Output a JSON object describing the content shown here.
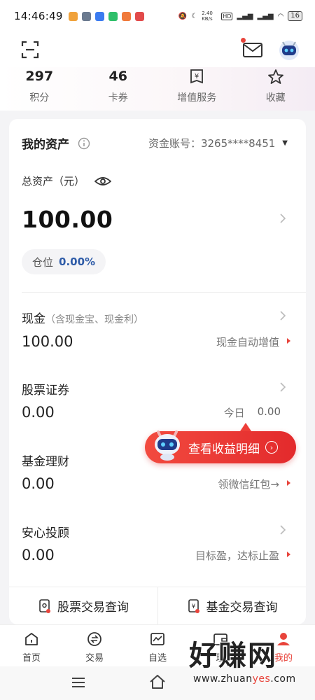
{
  "status_bar": {
    "time": "14:46:49",
    "net_speed": "2.40 KB/s",
    "battery": "16"
  },
  "stats": [
    {
      "value": "297",
      "label": "积分"
    },
    {
      "value": "46",
      "label": "卡券"
    },
    {
      "value": "",
      "label": "增值服务",
      "icon": "yen-bag-icon"
    },
    {
      "value": "",
      "label": "收藏",
      "icon": "star-icon"
    }
  ],
  "assets": {
    "title": "我的资产",
    "account": "资金账号：3265****8451",
    "total_label": "总资产（元）",
    "total_value": "100.00",
    "position_label": "仓位",
    "position_value": "0.00%"
  },
  "sections": {
    "cash": {
      "title": "现金",
      "subtitle": "（含现金宝、现金利）",
      "value": "100.00",
      "right": "现金自动增值"
    },
    "stock": {
      "title": "股票证券",
      "value": "0.00",
      "today_label": "今日",
      "today_value": "0.00"
    },
    "fund": {
      "title": "基金理财",
      "value": "0.00",
      "right": "领微信红包→"
    },
    "advisor": {
      "title": "安心投顾",
      "value": "0.00",
      "right": "目标盈，达标止盈"
    }
  },
  "promo": {
    "label": "查看收益明细",
    "arrow": "›"
  },
  "queries": {
    "stock": "股票交易查询",
    "fund": "基金交易查询"
  },
  "tabs": [
    {
      "label": "首页",
      "icon": "home-icon"
    },
    {
      "label": "交易",
      "icon": "trade-icon"
    },
    {
      "label": "自选",
      "icon": "chart-icon"
    },
    {
      "label": "理",
      "icon": "wallet-icon"
    },
    {
      "label": "我的",
      "icon": "user-icon"
    }
  ],
  "watermark": {
    "big": "好赚网",
    "small_pre": "www.zhuan",
    "small_y": "yes",
    "small_post": ".com"
  },
  "colors": {
    "accent": "#e8443b",
    "blue": "#2f5ca8"
  }
}
